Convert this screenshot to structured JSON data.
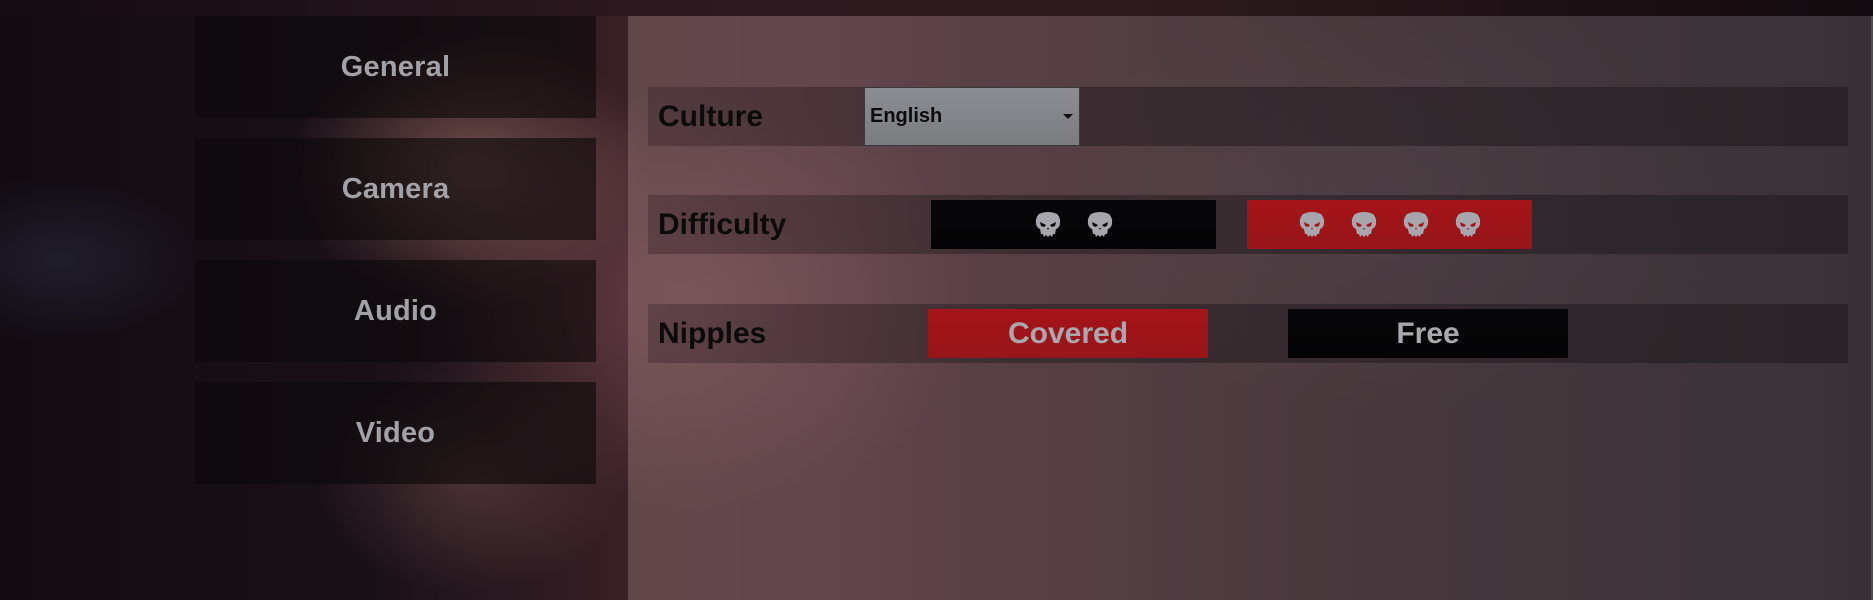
{
  "sidebar": {
    "items": [
      {
        "label": "General"
      },
      {
        "label": "Camera"
      },
      {
        "label": "Audio"
      },
      {
        "label": "Video"
      }
    ]
  },
  "settings": {
    "culture": {
      "label": "Culture",
      "selected": "English"
    },
    "difficulty": {
      "label": "Difficulty",
      "options": [
        {
          "icon": "skull-icon",
          "skull_count": 2,
          "selected": false
        },
        {
          "icon": "skull-icon",
          "skull_count": 4,
          "selected": true
        }
      ]
    },
    "nipples": {
      "label": "Nipples",
      "options": [
        {
          "label": "Covered",
          "selected": true
        },
        {
          "label": "Free",
          "selected": false
        }
      ]
    }
  },
  "colors": {
    "selected": "#a51418",
    "unselected": "#050506",
    "label_text": "#a2a1a8"
  }
}
